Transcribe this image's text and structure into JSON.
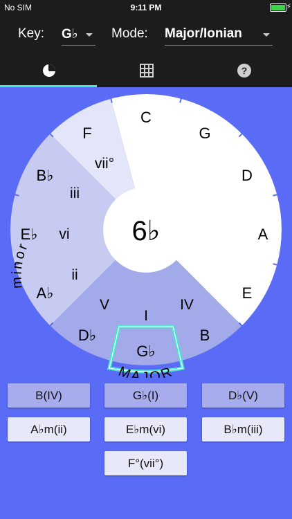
{
  "status": {
    "carrier": "No SIM",
    "time": "9:11 PM",
    "battery_level": 1.0
  },
  "header": {
    "key_label": "Key:",
    "key_value": "G♭",
    "mode_label": "Mode:",
    "mode_value": "Major/Ionian"
  },
  "tabs": [
    {
      "name": "wheel",
      "icon": "pie-chart-icon",
      "active": true
    },
    {
      "name": "grid",
      "icon": "grid-icon",
      "active": false
    },
    {
      "name": "help",
      "icon": "help-icon",
      "active": false
    }
  ],
  "wheel": {
    "center_label": "6♭",
    "major_arc_text": "MAJOR",
    "minor_arc_text": "minor",
    "outer_keys": [
      "C",
      "G",
      "D",
      "A",
      "E",
      "B",
      "G♭",
      "D♭",
      "A♭",
      "E♭",
      "B♭",
      "F"
    ],
    "roman_numerals": [
      "vii°",
      "iii",
      "vi",
      "ii",
      "V",
      "I",
      "IV"
    ],
    "colors": {
      "background": "#5a6cf5",
      "white": "#ffffff",
      "light": "#e3e5f8",
      "mid": "#c7cbf1",
      "dark": "#a3aaea",
      "ticks": "#5a6cf5",
      "highlight": "#46e6cf"
    }
  },
  "buttons": [
    {
      "label": "B(IV)"
    },
    {
      "label": "G♭(I)"
    },
    {
      "label": "D♭(V)"
    },
    {
      "label": "A♭m(ii)"
    },
    {
      "label": "E♭m(vi)"
    },
    {
      "label": "B♭m(iii)"
    },
    {
      "label": "F°(vii°)"
    }
  ]
}
